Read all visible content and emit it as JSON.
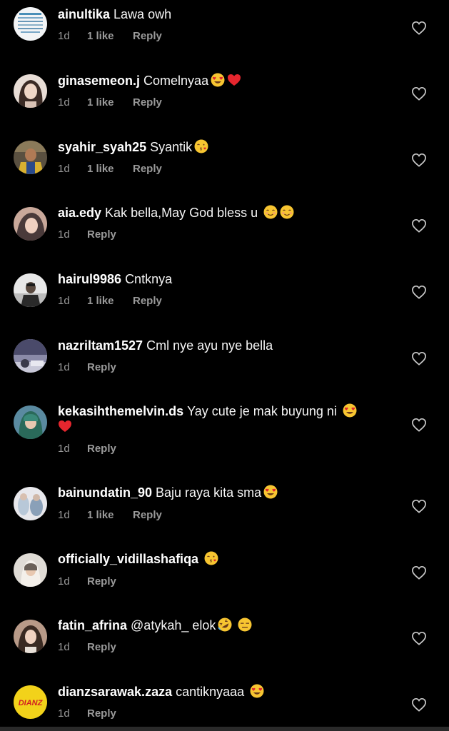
{
  "comments": [
    {
      "username": "ainultika",
      "text": "Lawa owh",
      "emojis": [],
      "time": "1d",
      "likes": "1 like",
      "reply": "Reply",
      "avatar_colors": [
        "#f2f4f6",
        "#4a8fb8"
      ]
    },
    {
      "username": "ginasemeon.j",
      "text": "Comelnyaa",
      "emojis": [
        "heart-eyes-emoji",
        "red-heart-emoji"
      ],
      "time": "1d",
      "likes": "1 like",
      "reply": "Reply",
      "avatar_colors": [
        "#d9c2b5",
        "#3a2a24"
      ]
    },
    {
      "username": "syahir_syah25",
      "text": "Syantik",
      "emojis": [
        "kiss-emoji"
      ],
      "time": "1d",
      "likes": "1 like",
      "reply": "Reply",
      "avatar_colors": [
        "#6a5a3a",
        "#d8b030"
      ]
    },
    {
      "username": "aia.edy",
      "text": "Kak bella,May God bless u",
      "emojis": [
        "smiling-blush-emoji",
        "smiling-blush-emoji"
      ],
      "time": "1d",
      "likes": "",
      "reply": "Reply",
      "avatar_colors": [
        "#c9a89a",
        "#4a3a3a"
      ]
    },
    {
      "username": "hairul9986",
      "text": "Cntknya",
      "emojis": [],
      "time": "1d",
      "likes": "1 like",
      "reply": "Reply",
      "avatar_colors": [
        "#e8e8e8",
        "#2a2a2a"
      ]
    },
    {
      "username": "nazriltam1527",
      "text": "Cml nye ayu nye bella",
      "emojis": [],
      "time": "1d",
      "likes": "",
      "reply": "Reply",
      "avatar_colors": [
        "#4a4a6a",
        "#c8c8d8"
      ]
    },
    {
      "username": "kekasihthemelvin.ds",
      "text": "Yay cute je mak buyung ni",
      "emojis": [
        "heart-eyes-emoji",
        "red-heart-emoji"
      ],
      "time": "1d",
      "likes": "",
      "reply": "Reply",
      "avatar_colors": [
        "#5a8aa0",
        "#2a6a5a"
      ]
    },
    {
      "username": "bainundatin_90",
      "text": "Baju raya kita sma",
      "emojis": [
        "heart-eyes-emoji"
      ],
      "time": "1d",
      "likes": "1 like",
      "reply": "Reply",
      "avatar_colors": [
        "#e8e8ec",
        "#8aa0b8"
      ]
    },
    {
      "username": "officially_vidillashafiqa",
      "text": "",
      "emojis": [
        "kiss-emoji"
      ],
      "time": "1d",
      "likes": "",
      "reply": "Reply",
      "avatar_colors": [
        "#e0dcd6",
        "#6a6058"
      ]
    },
    {
      "username": "fatin_afrina",
      "text": "@atykah_ elok",
      "emojis": [
        "rofl-emoji",
        "expressionless-emoji"
      ],
      "time": "1d",
      "likes": "",
      "reply": "Reply",
      "avatar_colors": [
        "#b89a88",
        "#3a2a22"
      ]
    },
    {
      "username": "dianzsarawak.zaza",
      "text": "cantiknyaaa",
      "emojis": [
        "heart-eyes-emoji"
      ],
      "time": "1d",
      "likes": "",
      "reply": "Reply",
      "avatar_colors": [
        "#f2d21a",
        "#d22020"
      ],
      "avatar_text": "DIANZ"
    }
  ],
  "colors": {
    "background": "#000000",
    "meta_text": "#9a9a9a",
    "heart_outline": "#c8c8c8"
  }
}
